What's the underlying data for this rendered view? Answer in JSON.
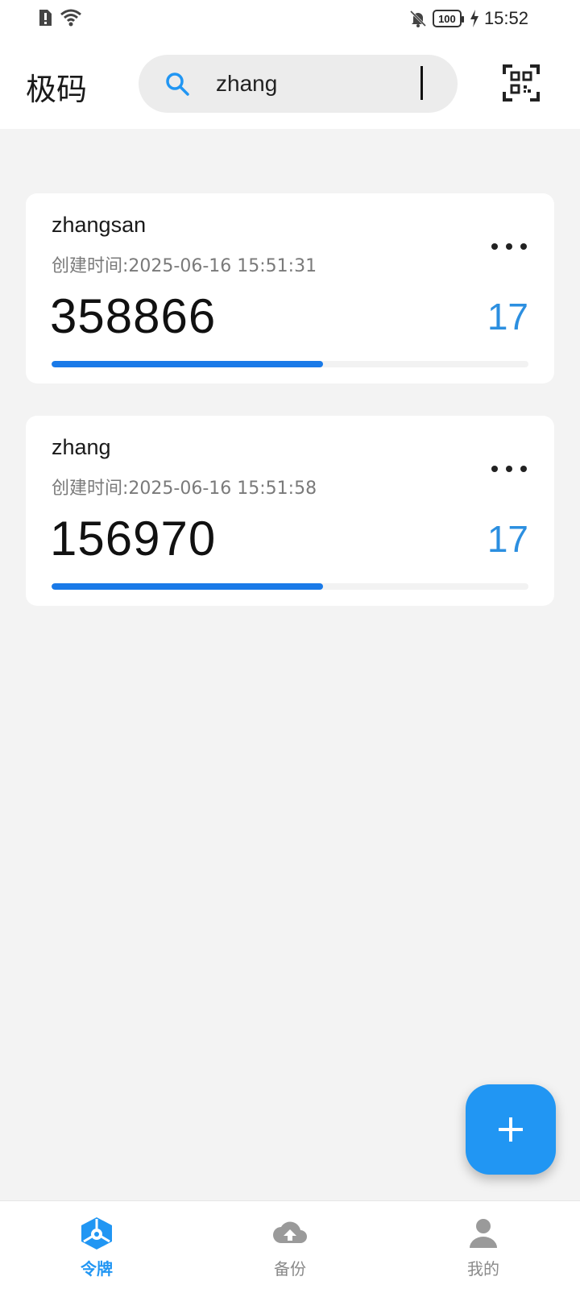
{
  "status_bar": {
    "time": "15:52",
    "battery": "100",
    "icons": [
      "alert-sim-icon",
      "wifi-icon",
      "bell-off-icon",
      "battery-icon",
      "charging-icon"
    ]
  },
  "header": {
    "app_title": "极码",
    "search": {
      "value": "zhang",
      "icon": "search-icon"
    },
    "scan_icon": "qr-scan-icon"
  },
  "tokens": [
    {
      "name": "zhangsan",
      "created": "创建时间:2025-06-16 15:51:31",
      "code": "358866",
      "seconds_left": "17",
      "progress": 0.57
    },
    {
      "name": "zhang",
      "created": "创建时间:2025-06-16 15:51:58",
      "code": "156970",
      "seconds_left": "17",
      "progress": 0.57
    }
  ],
  "fab": {
    "icon": "plus-icon"
  },
  "bottom_nav": {
    "items": [
      {
        "label": "令牌",
        "icon": "token-cube-icon",
        "active": true
      },
      {
        "label": "备份",
        "icon": "cloud-upload-icon",
        "active": false
      },
      {
        "label": "我的",
        "icon": "person-icon",
        "active": false
      }
    ]
  },
  "colors": {
    "accent": "#2196f3",
    "progress": "#1a7ae8",
    "timer": "#2c8fe0",
    "background": "#f3f3f3"
  }
}
